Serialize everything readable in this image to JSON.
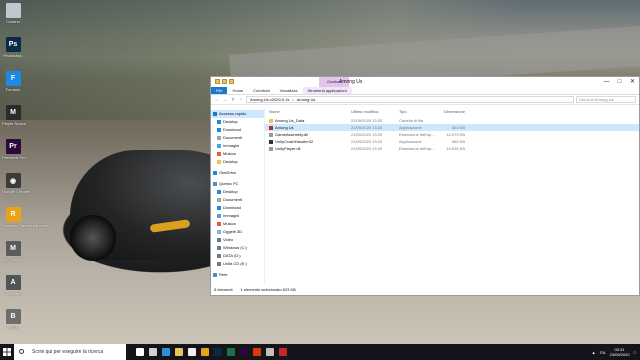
{
  "desktop_icons": [
    {
      "label": "Cestino",
      "icon": "recycle-bin-icon",
      "color": "#bfc7cf"
    },
    {
      "label": "Photoshop",
      "icon": "photoshop-icon",
      "color": "#0b2a4a",
      "glyph": "Ps"
    },
    {
      "label": "Formula",
      "icon": "formula-icon",
      "color": "#1e88e5",
      "glyph": "F"
    },
    {
      "label": "Player Scope",
      "icon": "player-scope-icon",
      "color": "#2b2b2b",
      "glyph": "M"
    },
    {
      "label": "Premiere Pro",
      "icon": "premiere-icon",
      "color": "#2a0a3a",
      "glyph": "Pr"
    },
    {
      "label": "Google Chrome",
      "icon": "chrome-icon",
      "color": "#3b3b3b",
      "glyph": "◉"
    },
    {
      "label": "Rockstar Games Launcher",
      "icon": "rockstar-icon",
      "color": "#e8a31b",
      "glyph": "R"
    },
    {
      "label": "MEGAsync",
      "icon": "megasync-icon",
      "color": "#5b5b5b",
      "glyph": "M"
    },
    {
      "label": "Avogadro",
      "icon": "avogadro-icon",
      "color": "#505558",
      "glyph": "A"
    },
    {
      "label": "BOSE",
      "icon": "bose-icon",
      "color": "#6d6d6d",
      "glyph": "B"
    }
  ],
  "explorer": {
    "title": "Among Us",
    "tools_tab": "Gestisci",
    "ribbon_tabs": [
      "File",
      "Home",
      "Condividi",
      "Visualizza",
      "Strumenti applicazioni"
    ],
    "path": [
      "Among.Us.v2020.9.1s",
      "Among Us"
    ],
    "search_placeholder": "Cerca in Among Us",
    "nav_items": [
      {
        "label": "Accesso rapido",
        "icon": "star-icon",
        "level": "top",
        "selected": true,
        "color": "#1979ca"
      },
      {
        "label": "Desktop",
        "icon": "desktop-icon",
        "level": "sub",
        "color": "#1e88e5"
      },
      {
        "label": "Download",
        "icon": "download-icon",
        "level": "sub",
        "color": "#1e88e5"
      },
      {
        "label": "Documenti",
        "icon": "documents-icon",
        "level": "sub",
        "color": "#9aa6b2"
      },
      {
        "label": "Immagini",
        "icon": "pictures-icon",
        "level": "sub",
        "color": "#4aa3df"
      },
      {
        "label": "Musica",
        "icon": "music-icon",
        "level": "sub",
        "color": "#e35d3a"
      },
      {
        "label": "Desktop",
        "icon": "folder-icon",
        "level": "sub",
        "color": "#e8c45c"
      },
      {
        "label": "OneDrive",
        "icon": "onedrive-icon",
        "level": "top",
        "color": "#1e88e5"
      },
      {
        "label": "Questo PC",
        "icon": "pc-icon",
        "level": "top",
        "color": "#4a90c2"
      },
      {
        "label": "Desktop",
        "icon": "desktop-icon",
        "level": "sub",
        "color": "#1e88e5"
      },
      {
        "label": "Documenti",
        "icon": "documents-icon",
        "level": "sub",
        "color": "#9aa6b2"
      },
      {
        "label": "Download",
        "icon": "download-icon",
        "level": "sub",
        "color": "#1e88e5"
      },
      {
        "label": "Immagini",
        "icon": "pictures-icon",
        "level": "sub",
        "color": "#4aa3df"
      },
      {
        "label": "Musica",
        "icon": "music-icon",
        "level": "sub",
        "color": "#e35d3a"
      },
      {
        "label": "Oggetti 3D",
        "icon": "objects-3d-icon",
        "level": "sub",
        "color": "#7ab8e0"
      },
      {
        "label": "Video",
        "icon": "video-icon",
        "level": "sub",
        "color": "#6a7a8a"
      },
      {
        "label": "Windows (C:)",
        "icon": "drive-icon",
        "level": "sub",
        "color": "#6a7a8a"
      },
      {
        "label": "DATA (D:)",
        "icon": "drive-icon",
        "level": "sub",
        "color": "#6a7a8a"
      },
      {
        "label": "Unità CD (E:)",
        "icon": "cd-drive-icon",
        "level": "sub",
        "color": "#6a7a8a"
      },
      {
        "label": "Rete",
        "icon": "network-icon",
        "level": "top",
        "color": "#4a90c2"
      }
    ],
    "columns": [
      "Nome",
      "Ultima modifica",
      "Tipo",
      "Dimensione"
    ],
    "files": [
      {
        "name": "Among Us_Data",
        "modified": "21/09/2020 13:20",
        "type": "Cartella di file",
        "size": "",
        "icon": "folder-icon",
        "color": "#e8c45c",
        "selected": false
      },
      {
        "name": "Among Us",
        "modified": "21/09/2020 13:20",
        "type": "Applicazione",
        "size": "623 KB",
        "icon": "among-us-icon",
        "color": "#c62828",
        "selected": true
      },
      {
        "name": "GameAssembly.dll",
        "modified": "21/09/2020 13:20",
        "type": "Estensione dell'ap...",
        "size": "14.079 KB",
        "icon": "dll-icon",
        "color": "#8d99a6",
        "selected": false
      },
      {
        "name": "UnityCrashHandler32",
        "modified": "21/09/2020 13:20",
        "type": "Applicazione",
        "size": "960 KB",
        "icon": "unity-icon",
        "color": "#333333",
        "selected": false
      },
      {
        "name": "UnityPlayer.dll",
        "modified": "21/09/2020 13:20",
        "type": "Estensione dell'ap...",
        "size": "19.626 KB",
        "icon": "dll-icon",
        "color": "#8d99a6",
        "selected": false
      }
    ],
    "status_count": "5 elementi",
    "status_selected": "1 elemento selezionato  623 KB"
  },
  "taskbar": {
    "search_placeholder": "Scrivi qui per eseguire la ricerca",
    "apps": [
      {
        "icon": "cortana-icon",
        "color": "#ffffff"
      },
      {
        "icon": "task-view-icon",
        "color": "#d0d0d0"
      },
      {
        "icon": "edge-icon",
        "color": "#2f8fd8"
      },
      {
        "icon": "file-explorer-icon",
        "color": "#e8c45c"
      },
      {
        "icon": "store-icon",
        "color": "#f0f0f0"
      },
      {
        "icon": "chrome-icon",
        "color": "#e8a31b"
      },
      {
        "icon": "photoshop-icon",
        "color": "#0b2a4a"
      },
      {
        "icon": "excel-icon",
        "color": "#1e7145"
      },
      {
        "icon": "premiere-icon",
        "color": "#2a0a3a"
      },
      {
        "icon": "office-icon",
        "color": "#d83b01"
      },
      {
        "icon": "steam-icon",
        "color": "#c0c0c0"
      },
      {
        "icon": "among-us-icon",
        "color": "#c62828"
      }
    ],
    "lang": "ITA",
    "time": "00:31",
    "date": "23/09/2020"
  }
}
